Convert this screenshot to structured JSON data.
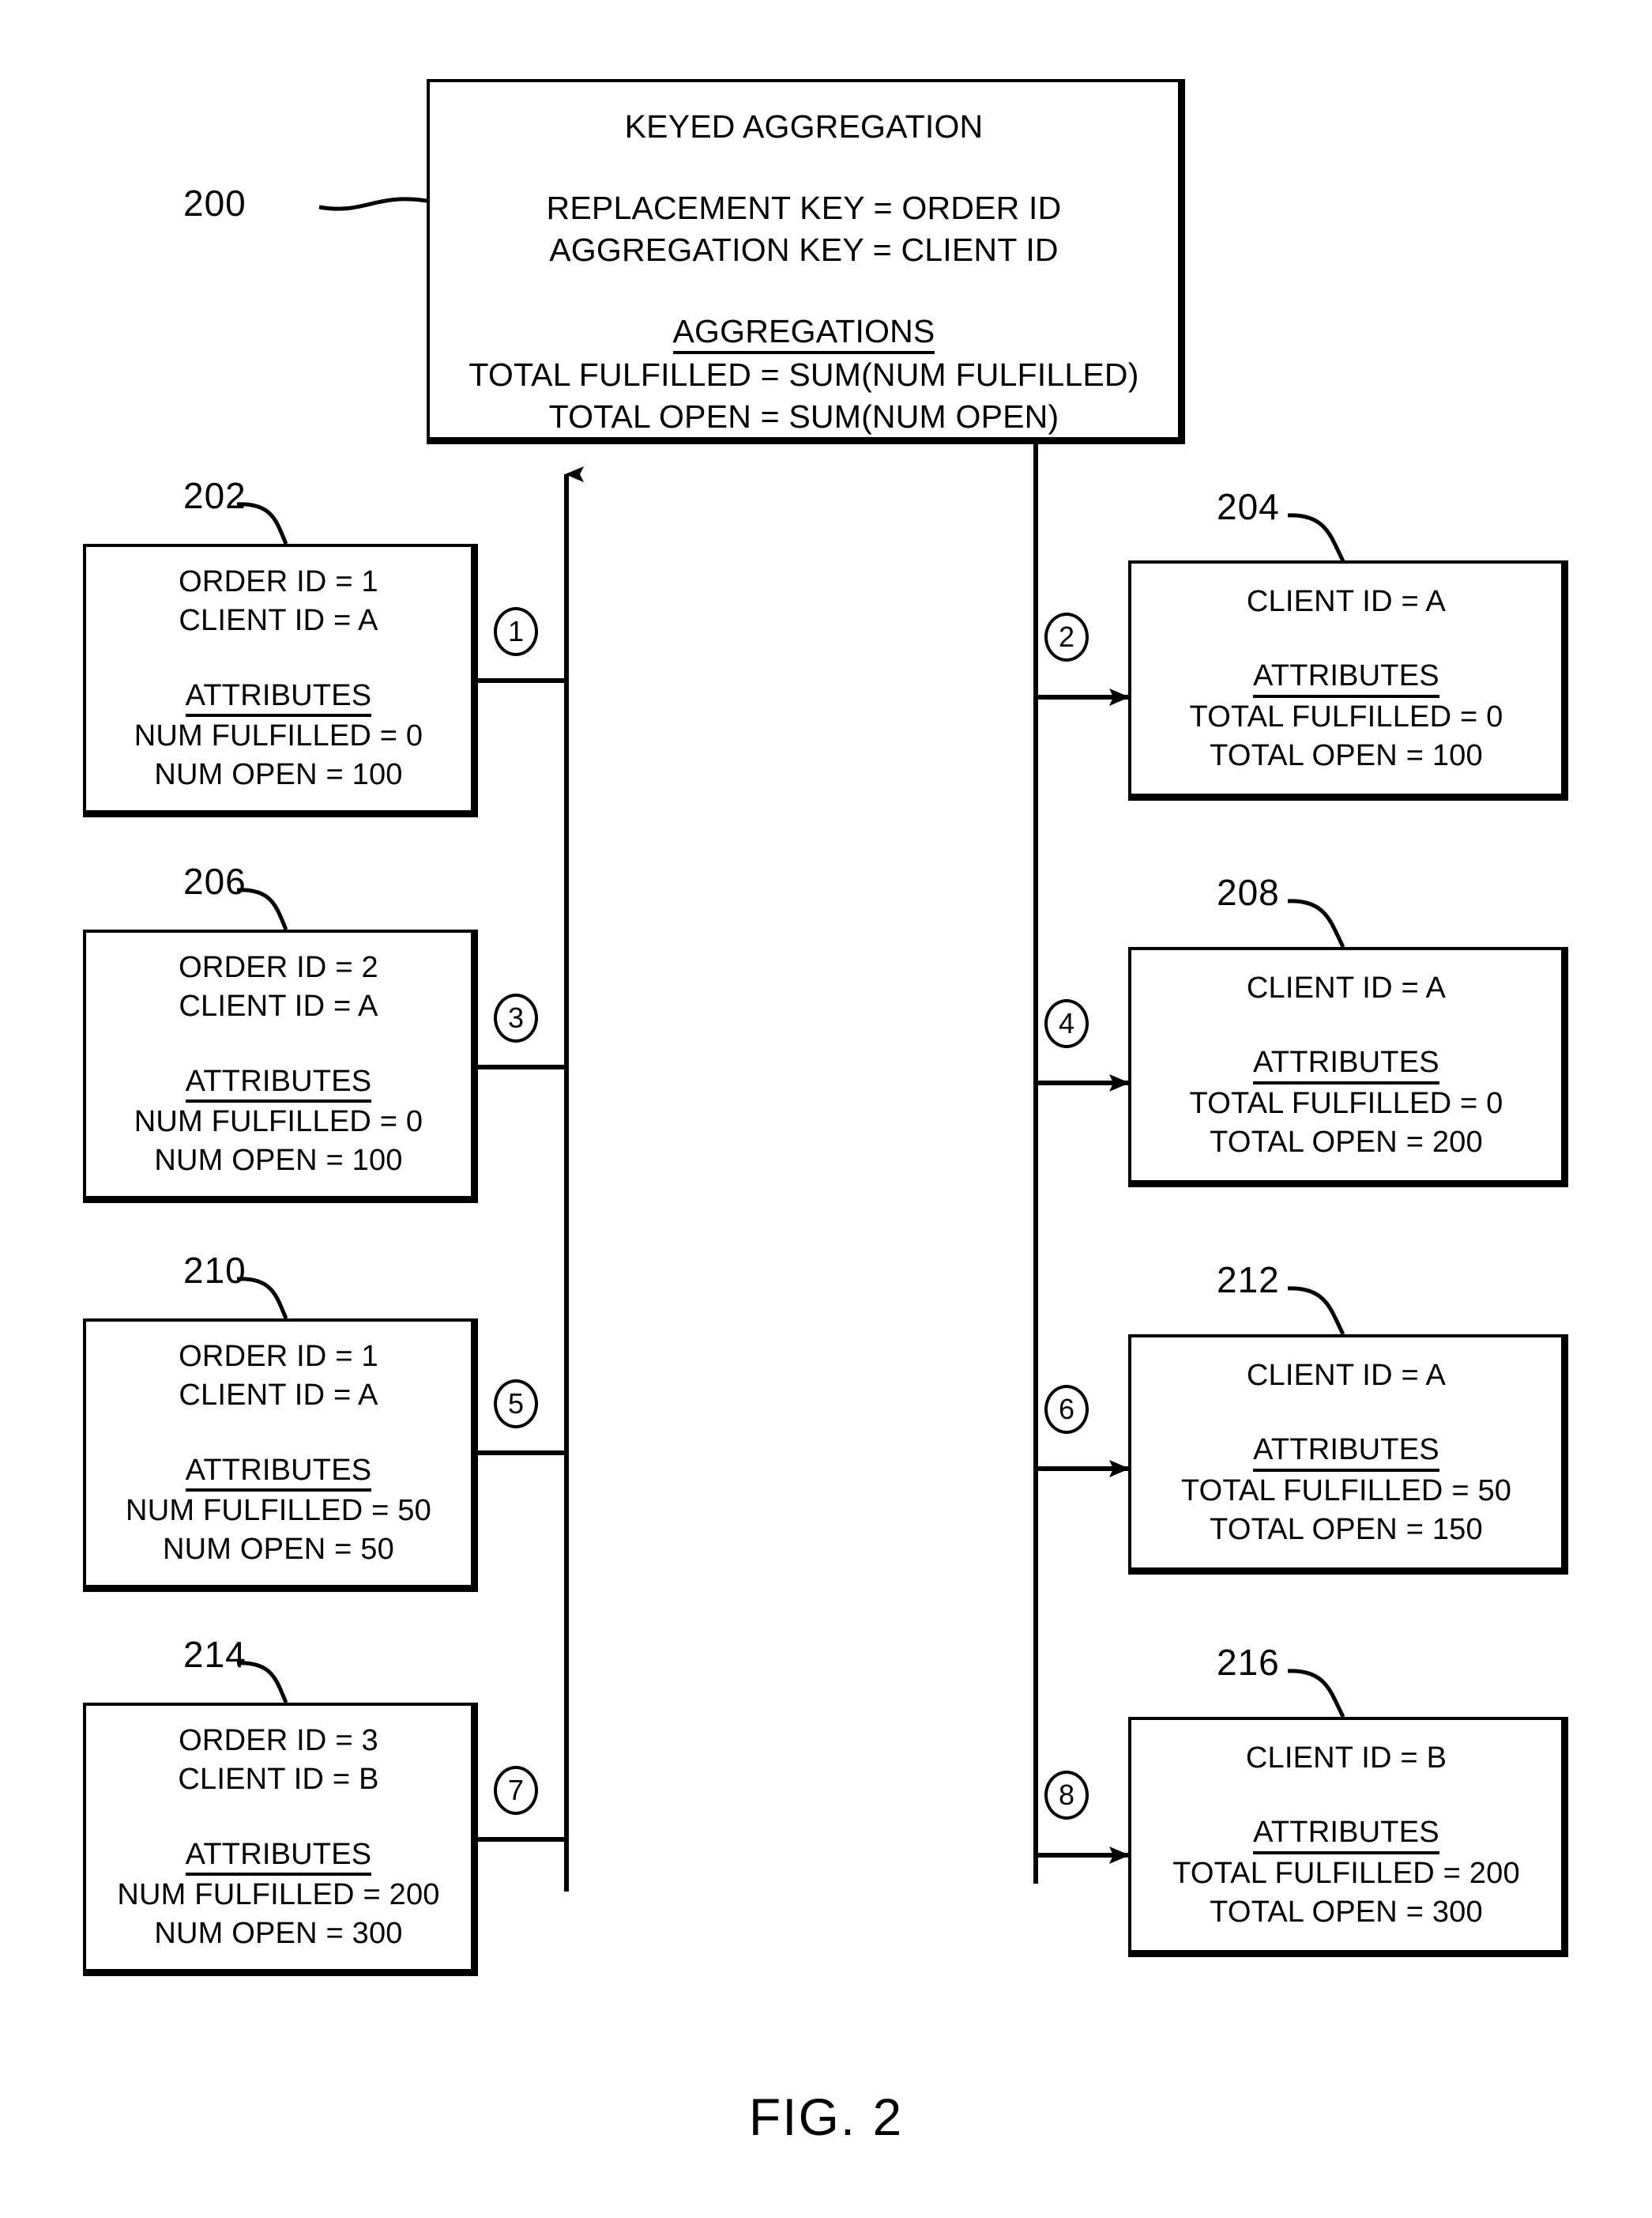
{
  "figure": {
    "caption": "FIG. 2",
    "numeral_200": "200"
  },
  "aggregation_node": {
    "ref": "200",
    "title": "KEYED AGGREGATION",
    "replacement_key": "REPLACEMENT KEY = ORDER ID",
    "aggregation_key": "AGGREGATION KEY = CLIENT ID",
    "aggregations_heading": "AGGREGATIONS",
    "agg_line_1": "TOTAL FULFILLED = SUM(NUM FULFILLED)",
    "agg_line_2": "TOTAL OPEN = SUM(NUM OPEN)"
  },
  "input_nodes": [
    {
      "ref": "202",
      "step": "1",
      "order_id": "ORDER ID = 1",
      "client_id": "CLIENT ID = A",
      "attributes_heading": "ATTRIBUTES",
      "attr_1": "NUM FULFILLED = 0",
      "attr_2": "NUM OPEN = 100"
    },
    {
      "ref": "206",
      "step": "3",
      "order_id": "ORDER ID = 2",
      "client_id": "CLIENT ID = A",
      "attributes_heading": "ATTRIBUTES",
      "attr_1": "NUM FULFILLED = 0",
      "attr_2": "NUM OPEN = 100"
    },
    {
      "ref": "210",
      "step": "5",
      "order_id": "ORDER ID = 1",
      "client_id": "CLIENT ID = A",
      "attributes_heading": "ATTRIBUTES",
      "attr_1": "NUM FULFILLED = 50",
      "attr_2": "NUM OPEN = 50"
    },
    {
      "ref": "214",
      "step": "7",
      "order_id": "ORDER ID = 3",
      "client_id": "CLIENT ID = B",
      "attributes_heading": "ATTRIBUTES",
      "attr_1": "NUM FULFILLED = 200",
      "attr_2": "NUM OPEN = 300"
    }
  ],
  "output_nodes": [
    {
      "ref": "204",
      "step": "2",
      "client_id": "CLIENT ID = A",
      "attributes_heading": "ATTRIBUTES",
      "attr_1": "TOTAL FULFILLED = 0",
      "attr_2": "TOTAL OPEN = 100"
    },
    {
      "ref": "208",
      "step": "4",
      "client_id": "CLIENT ID = A",
      "attributes_heading": "ATTRIBUTES",
      "attr_1": "TOTAL FULFILLED = 0",
      "attr_2": "TOTAL OPEN = 200"
    },
    {
      "ref": "212",
      "step": "6",
      "client_id": "CLIENT ID = A",
      "attributes_heading": "ATTRIBUTES",
      "attr_1": "TOTAL FULFILLED = 50",
      "attr_2": "TOTAL OPEN = 150"
    },
    {
      "ref": "216",
      "step": "8",
      "client_id": "CLIENT ID = B",
      "attributes_heading": "ATTRIBUTES",
      "attr_1": "TOTAL FULFILLED = 200",
      "attr_2": "TOTAL OPEN = 300"
    }
  ],
  "colors": {
    "ink": "#000000",
    "paper": "#ffffff"
  }
}
